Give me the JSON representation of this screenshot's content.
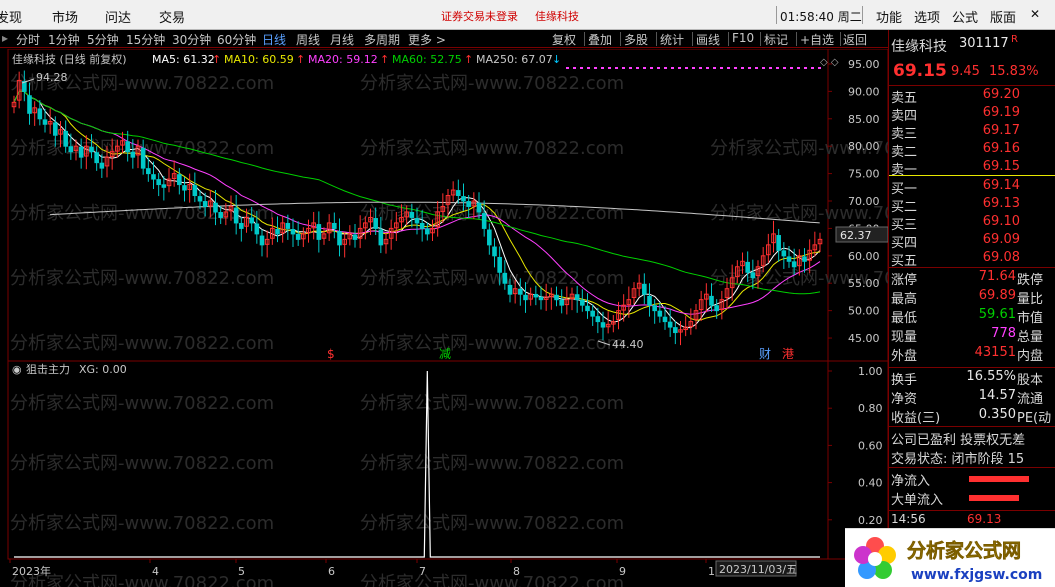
{
  "menubar": {
    "items": [
      "发现",
      "市场",
      "问达",
      "交易"
    ],
    "status_login": "证券交易未登录",
    "status_stock": "佳缘科技",
    "clock": "01:58:40 周二",
    "right_items": [
      "功能",
      "选项",
      "公式",
      "版面"
    ]
  },
  "toolbar": {
    "periods": [
      "分时",
      "1分钟",
      "5分钟",
      "15分钟",
      "30分钟",
      "60分钟",
      "日线",
      "周线",
      "月线",
      "多周期",
      "更多 >"
    ],
    "active_period": "日线",
    "tools": [
      "复权",
      "叠加",
      "多股",
      "统计",
      "画线",
      "F10",
      "标记",
      "+自选",
      "返回"
    ]
  },
  "chart": {
    "main_title": "佳缘科技 (日线 前复权)",
    "ma_labels": [
      {
        "text": "MA5: 61.32",
        "arrow": "↑",
        "color": "#ffffff"
      },
      {
        "text": "MA10: 60.59",
        "arrow": "↑",
        "color": "#e8e800"
      },
      {
        "text": "MA20: 59.12",
        "arrow": "↑",
        "color": "#ff40ff"
      },
      {
        "text": "MA60: 52.75",
        "arrow": "↑",
        "color": "#00d000"
      },
      {
        "text": "MA250: 67.07",
        "arrow": "↓",
        "color": "#c8c8c8"
      }
    ],
    "price_axis": [
      "95.00",
      "90.00",
      "85.00",
      "80.00",
      "75.00",
      "70.00",
      "65.00",
      "60.00",
      "55.00",
      "50.00",
      "45.00"
    ],
    "price_range": [
      43,
      97
    ],
    "high_label": "94.28",
    "low_label": "44.40",
    "current_price_box": "62.37",
    "event_markers": [
      {
        "text": "$",
        "color": "#ff3030"
      },
      {
        "text": "减",
        "color": "#00d000"
      },
      {
        "text": "财",
        "color": "#5aa0ff"
      },
      {
        "text": "港",
        "color": "#ff3030"
      }
    ],
    "sub_title": "狙击主力",
    "sub_value": "XG: 0.00",
    "sub_axis": [
      "1.00",
      "0.80",
      "0.60",
      "0.40",
      "0.20"
    ],
    "x_labels": [
      "2023年",
      "4",
      "5",
      "6",
      "7",
      "8",
      "9",
      "1"
    ],
    "date_box": "2023/11/03/五",
    "watermark": "分析家公式网-www.70822.com",
    "colors": {
      "up": "#ff3030",
      "down": "#00c8c8",
      "ma5": "#ffffff",
      "ma10": "#e8e800",
      "ma20": "#ff40ff",
      "ma60": "#00d000",
      "ma250": "#c8c8c8"
    }
  },
  "chart_data": {
    "type": "candlestick",
    "title": "佳缘科技 (日线 前复权)",
    "ylim": [
      43,
      97
    ],
    "close": [
      88,
      92,
      90,
      86,
      87,
      85,
      84,
      84.5,
      82,
      83,
      80,
      79,
      80,
      78,
      80,
      79,
      77,
      76,
      78,
      79,
      80,
      81,
      79,
      78,
      80,
      76,
      75,
      74,
      73,
      72.5,
      74,
      75,
      73,
      72,
      73,
      71,
      70,
      69,
      70,
      68,
      67,
      68,
      69,
      66,
      65,
      67,
      66,
      64,
      62,
      63,
      65,
      64,
      66,
      65,
      64,
      63,
      64,
      65,
      66,
      63,
      64,
      66,
      65,
      62,
      63,
      64,
      63,
      65,
      66,
      67,
      65,
      62,
      63,
      65,
      66,
      67,
      68,
      67,
      66,
      65,
      64,
      65,
      68,
      69,
      71,
      72,
      71,
      70,
      69,
      70,
      68,
      65,
      62,
      60,
      57,
      55,
      53,
      54,
      53,
      52,
      53,
      52.5,
      52,
      52.5,
      53,
      52,
      51,
      52,
      53,
      52,
      51,
      50,
      49,
      48,
      47,
      47.5,
      48,
      50,
      51,
      52,
      54,
      55,
      53,
      51,
      50,
      49,
      48,
      47,
      46,
      46.5,
      47,
      48,
      50,
      52,
      53,
      51,
      50,
      52,
      54,
      56,
      58,
      59,
      57,
      56,
      58,
      60,
      62,
      64,
      61,
      60,
      59,
      58,
      60,
      59,
      61,
      62,
      63
    ],
    "ma": [
      {
        "name": "MA5",
        "value": 61.32
      },
      {
        "name": "MA10",
        "value": 60.59
      },
      {
        "name": "MA20",
        "value": 59.12
      },
      {
        "name": "MA60",
        "value": 52.75
      },
      {
        "name": "MA250",
        "value": 67.07
      }
    ],
    "indicator": {
      "name": "狙击主力",
      "xg_last": 0.0,
      "signal_index": 80,
      "signal_value": 1.0
    }
  },
  "panel": {
    "stock_name": "佳缘科技",
    "stock_code": "301117",
    "flag": "R",
    "price": "69.15",
    "change": "9.45",
    "change_pct": "15.83%",
    "asks": [
      {
        "label": "卖五",
        "price": "69.20"
      },
      {
        "label": "卖四",
        "price": "69.19"
      },
      {
        "label": "卖三",
        "price": "69.17"
      },
      {
        "label": "卖二",
        "price": "69.16"
      },
      {
        "label": "卖一",
        "price": "69.15"
      }
    ],
    "bids": [
      {
        "label": "买一",
        "price": "69.14"
      },
      {
        "label": "买二",
        "price": "69.13"
      },
      {
        "label": "买三",
        "price": "69.10"
      },
      {
        "label": "买四",
        "price": "69.09"
      },
      {
        "label": "买五",
        "price": "69.08"
      }
    ],
    "stats": [
      {
        "label": "涨停",
        "value": "71.64",
        "color": "red",
        "label2": "跌停"
      },
      {
        "label": "最高",
        "value": "69.89",
        "color": "red",
        "label2": "量比"
      },
      {
        "label": "最低",
        "value": "59.61",
        "color": "green",
        "label2": "市值"
      },
      {
        "label": "现量",
        "value": "778",
        "color": "magenta",
        "label2": "总量"
      },
      {
        "label": "外盘",
        "value": "43151",
        "color": "red",
        "label2": "内盘"
      }
    ],
    "stats2": [
      {
        "label": "换手",
        "value": "16.55%",
        "label2": "股本"
      },
      {
        "label": "净资",
        "value": "14.57",
        "label2": "流通"
      },
      {
        "label": "收益(三)",
        "value": "0.350",
        "label2": "PE(动"
      }
    ],
    "company": "公司已盈利 投票权无差",
    "trade_state": "交易状态: 闭市阶段 15",
    "flow_net": "净流入",
    "flow_big": "大单流入",
    "tick_time": "14:56",
    "tick_price": "69.13"
  },
  "logo": {
    "text": "分析家公式网",
    "url": "www.fxjgsw.com"
  }
}
